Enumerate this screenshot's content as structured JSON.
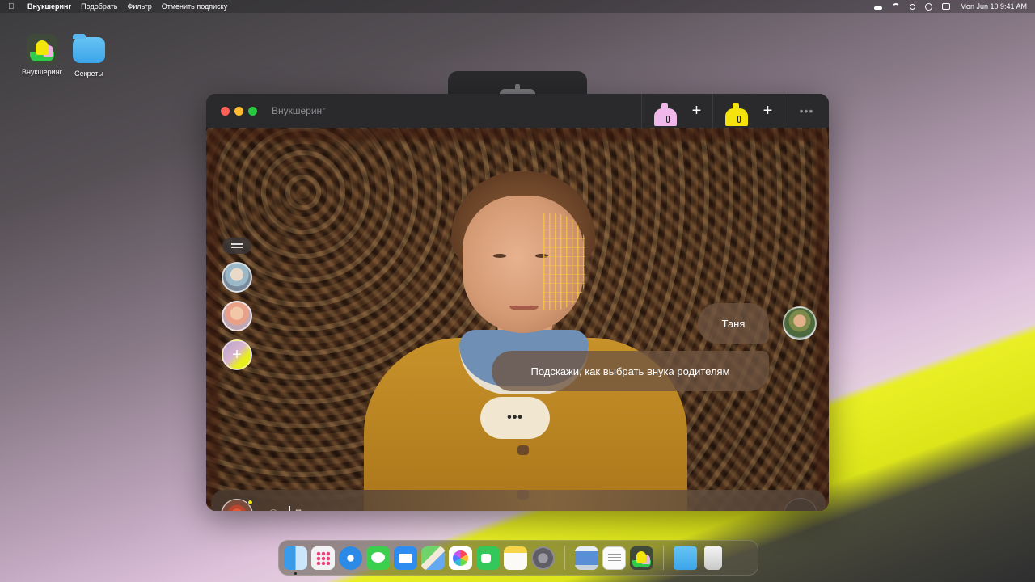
{
  "menubar": {
    "app_name": "Внукшеринг",
    "items": [
      "Подобрать",
      "Фильтр",
      "Отменить подписку"
    ],
    "datetime": "Mon Jun 10  9:41 AM"
  },
  "desktop": {
    "icons": [
      {
        "label": "Внукшеринг"
      },
      {
        "label": "Секреты"
      }
    ]
  },
  "window": {
    "title": "Внукшеринг",
    "plus_symbol": "+",
    "more_symbol": "•••"
  },
  "chat": {
    "sender_name": "Таня",
    "message": "Подскажи, как выбрать внука родителям",
    "typing": "•••"
  },
  "rail": {
    "add_symbol": "+"
  },
  "input": {
    "placeholder": "Ласточка, спроси меня что угодно",
    "send_symbol": "›"
  },
  "colors": {
    "accent_yellow": "#f4e30c",
    "accent_pink": "#f0b8ea",
    "green": "#2ecc4a"
  },
  "icons": [
    "apple-icon",
    "mic-icon",
    "filter-icon",
    "send-icon",
    "hamburger-icon"
  ],
  "dock": {
    "apps": [
      "finder",
      "launchpad",
      "safari",
      "messages",
      "mail",
      "maps",
      "photos",
      "facetime",
      "notes",
      "system-settings",
      "preview",
      "textedit",
      "vnuksharing",
      "downloads-folder",
      "trash"
    ]
  }
}
